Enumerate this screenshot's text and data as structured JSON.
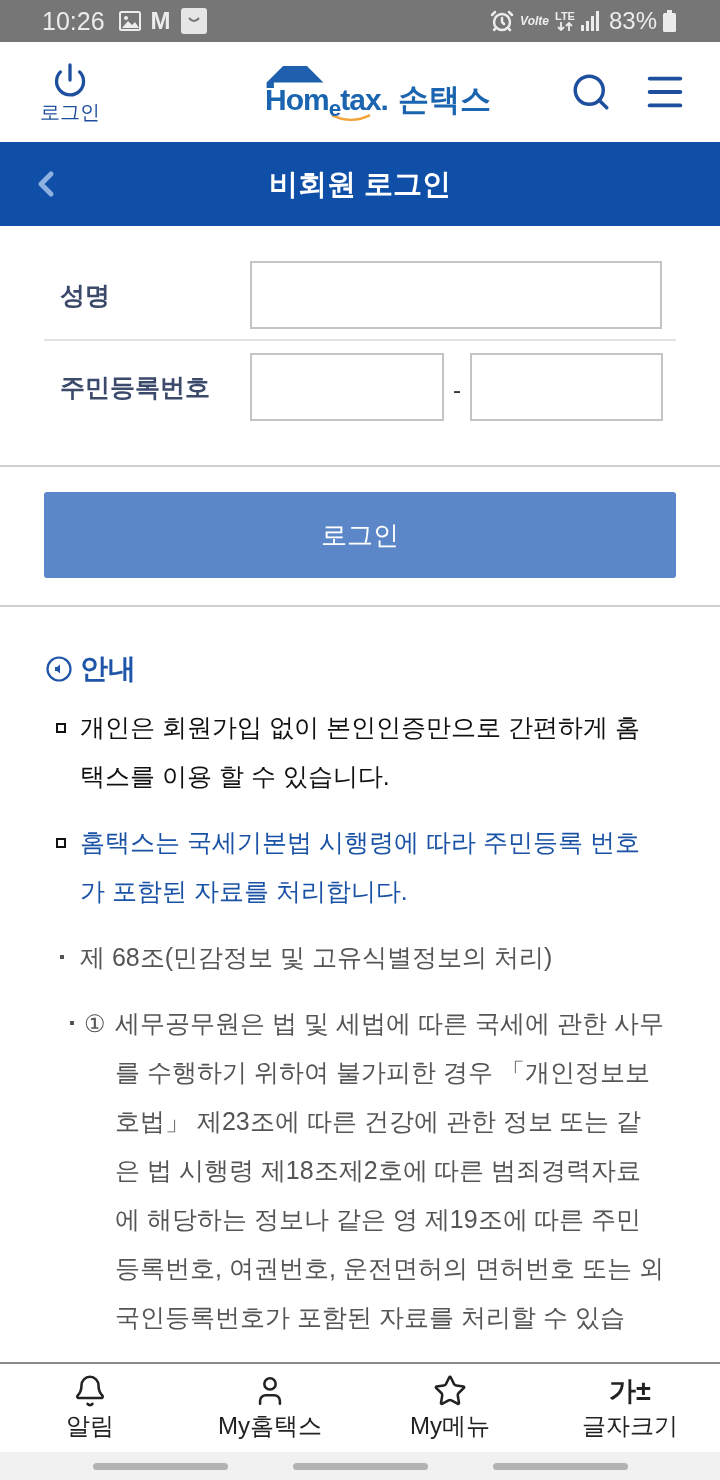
{
  "status_bar": {
    "time": "10:26",
    "notifications": [
      {
        "kind": "image"
      },
      {
        "kind": "letter",
        "text": "M"
      },
      {
        "kind": "bag"
      }
    ],
    "volte": "Volte",
    "network": "LTE",
    "battery": "83%"
  },
  "header": {
    "login_label": "로그인",
    "logo_text": "Hom$_{e}$tax.",
    "logo_subtitle": "손택스"
  },
  "title_bar": {
    "title": "비회원 로그인"
  },
  "form": {
    "rows": [
      {
        "kind": "single",
        "label": "성명"
      },
      {
        "kind": "split",
        "label": "주민등록번호",
        "separator": "-"
      }
    ]
  },
  "login_button": "로그인",
  "notice": {
    "title": "안내",
    "items": [
      {
        "kind": "note",
        "text": "개인은 회원가입 없이 본인인증만으로 간편하게 홈택스를 이용 할 수 있습니다."
      },
      {
        "kind": "emphasis",
        "text": "홈택스는 국세기본법 시행령에 따라 주민등록 번호가 포함된 자료를 처리합니다."
      },
      {
        "kind": "article",
        "text": "제 68조(민감정보 및 고유식별정보의 처리)"
      },
      {
        "kind": "clause",
        "marker": "①",
        "text": "세무공무원은 법 및 세법에 따른 국세에 관한 사무를 수행하기 위하여 불가피한 경우 「개인정보보호법」 제23조에 따른 건강에 관한 정보 또는 같은 법 시행령 제18조제2호에 따른 범죄경력자료에 해당하는 정보나 같은 영 제19조에 따른 주민등록번호, 여권번호, 운전면허의 면허번호 또는 외국인등록번호가 포함된 자료를 처리할 수 있습"
      }
    ]
  },
  "bottom_nav": [
    {
      "kind": "bell",
      "label": "알림"
    },
    {
      "kind": "person",
      "label": "My홈택스"
    },
    {
      "kind": "star",
      "label": "My메뉴"
    },
    {
      "kind": "glyph",
      "glyph": "가±",
      "label": "글자크기"
    }
  ]
}
